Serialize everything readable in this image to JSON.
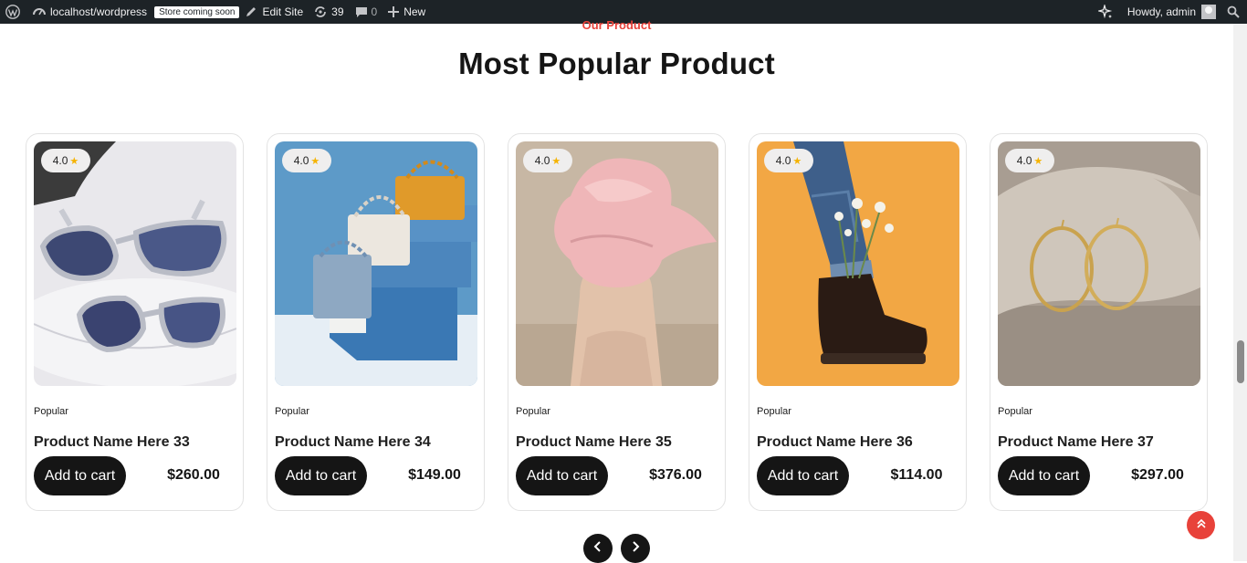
{
  "admin_bar": {
    "site": "localhost/wordpress",
    "store_badge": "Store coming soon",
    "edit_site": "Edit Site",
    "updates_count": "39",
    "comments_count": "0",
    "new_label": "New",
    "howdy": "Howdy, admin"
  },
  "section": {
    "kicker": "Our Product",
    "title": "Most Popular Product"
  },
  "products": [
    {
      "rating": "4.0",
      "category": "Popular",
      "name": "Product Name Here 33",
      "button": "Add to cart",
      "price": "$260.00",
      "image": "sunglasses"
    },
    {
      "rating": "4.0",
      "category": "Popular",
      "name": "Product Name Here 34",
      "button": "Add to cart",
      "price": "$149.00",
      "image": "handbags"
    },
    {
      "rating": "4.0",
      "category": "Popular",
      "name": "Product Name Here 35",
      "button": "Add to cart",
      "price": "$376.00",
      "image": "pink-scarf"
    },
    {
      "rating": "4.0",
      "category": "Popular",
      "name": "Product Name Here 36",
      "button": "Add to cart",
      "price": "$114.00",
      "image": "boots-flowers"
    },
    {
      "rating": "4.0",
      "category": "Popular",
      "name": "Product Name Here 37",
      "button": "Add to cart",
      "price": "$297.00",
      "image": "hoop-earrings"
    }
  ],
  "icons": {
    "wordpress": "wordpress-logo-icon",
    "dashboard": "dashboard-icon",
    "edit": "edit-site-icon",
    "updates": "updates-icon",
    "comments": "comments-icon",
    "new": "plus-icon",
    "ai": "sparkle-icon",
    "search": "search-icon",
    "prev": "chevron-left-icon",
    "next": "chevron-right-icon",
    "top": "chevron-up-icon",
    "star": "star-icon"
  },
  "colors": {
    "accent": "#e8423a",
    "button": "#151515",
    "admin_bar": "#1d2327",
    "star": "#f5b301"
  }
}
